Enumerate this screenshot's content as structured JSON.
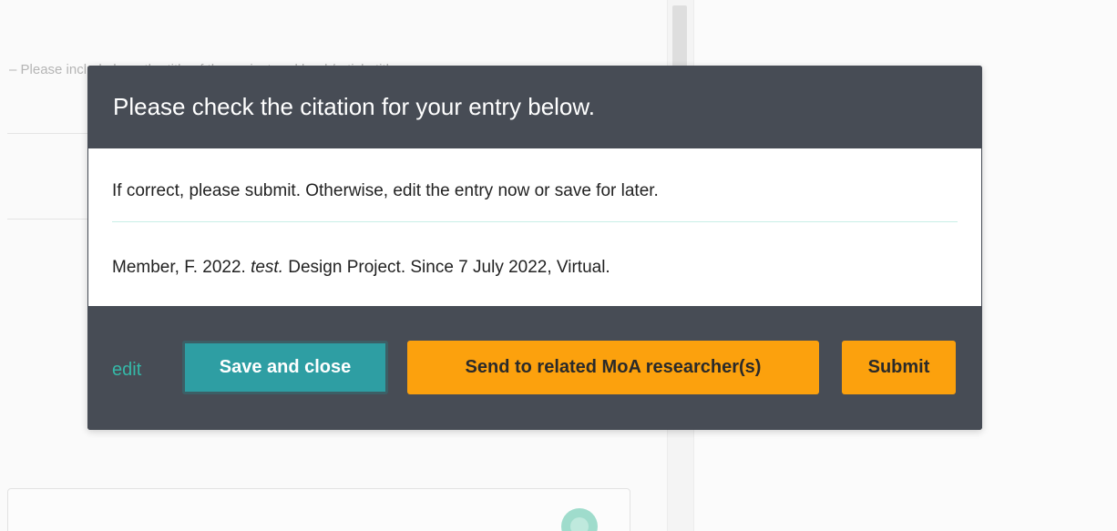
{
  "background": {
    "hint_text": "– Please include here the title of the project and book/article title...",
    "colors": {
      "page": "#fafafa",
      "accent_circle": "#9fdccc"
    }
  },
  "modal": {
    "title": "Please check the citation for your entry below.",
    "instruction": "If correct, please submit. Otherwise, edit the entry now or save for later.",
    "citation": {
      "prefix": "Member, F. 2022.",
      "title_italic": "test.",
      "suffix": "Design Project. Since 7 July 2022, Virtual."
    },
    "footer": {
      "edit_label": "edit",
      "save_label": "Save and close",
      "send_label": "Send to related MoA researcher(s)",
      "submit_label": "Submit"
    },
    "colors": {
      "header_bg": "#474c55",
      "teal": "#2e9ea3",
      "edit_link": "#35b8a8",
      "orange": "#fca10d"
    }
  }
}
